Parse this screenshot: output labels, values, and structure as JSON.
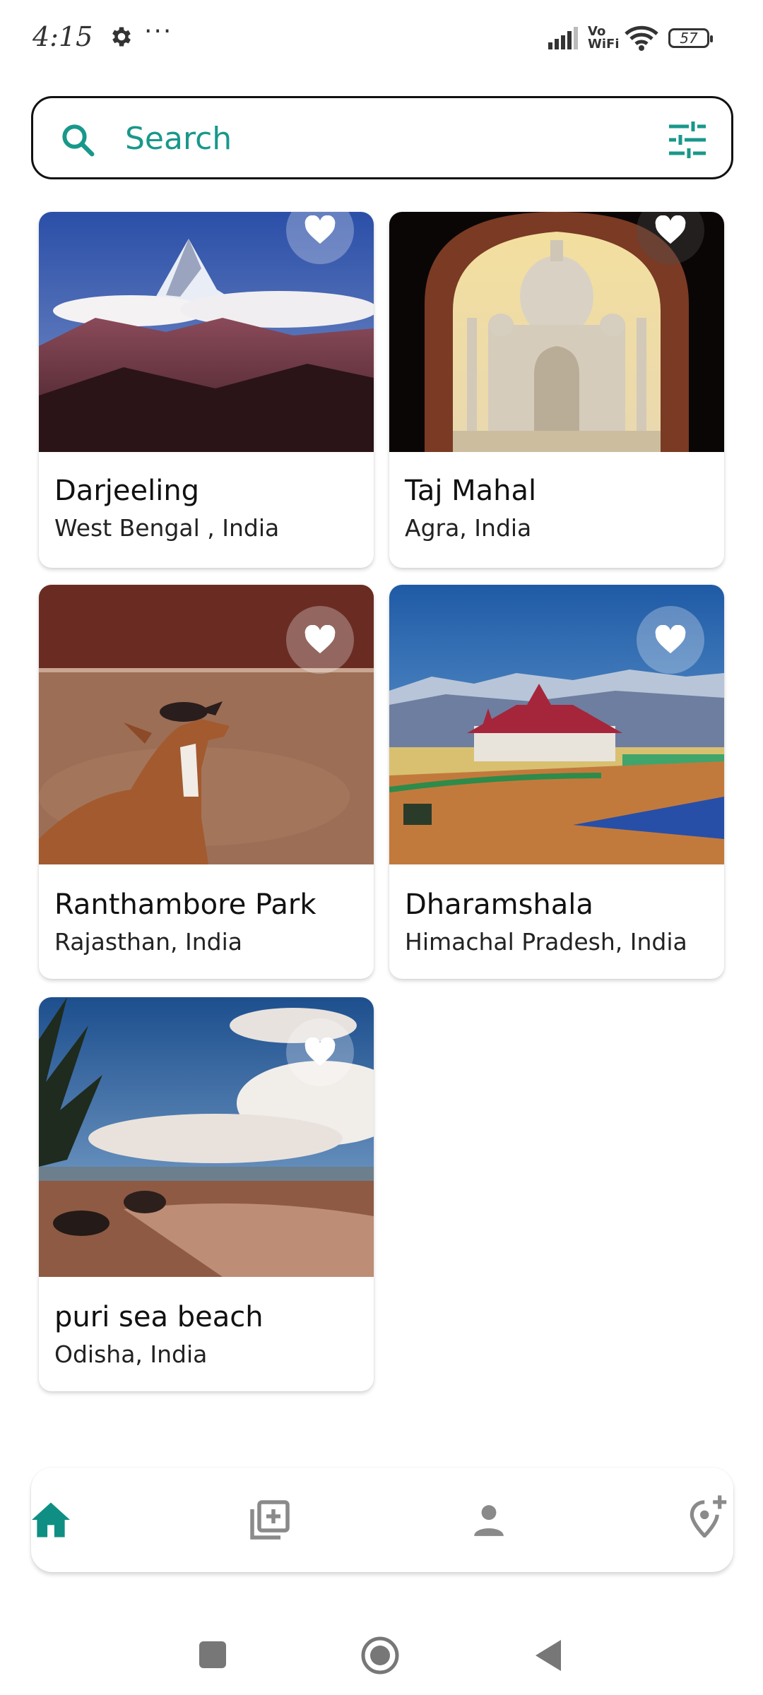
{
  "status_bar": {
    "time": "4:15",
    "more": "···",
    "network_label_top": "Vo",
    "network_label_bottom": "WiFi",
    "battery": "57"
  },
  "search": {
    "placeholder": "Search",
    "value": "",
    "accent_color": "#18988b"
  },
  "places": [
    {
      "name": "Darjeeling",
      "location": "West Bengal , India",
      "photo": "mountain-photo",
      "favorite": true
    },
    {
      "name": "Taj Mahal",
      "location": "Agra, India",
      "photo": "taj-mahal-photo",
      "favorite": true
    },
    {
      "name": "Ranthambore Park",
      "location": "Rajasthan, India",
      "photo": "deer-photo",
      "favorite": true
    },
    {
      "name": "Dharamshala",
      "location": "Himachal Pradesh, India",
      "photo": "stadium-photo",
      "favorite": true
    },
    {
      "name": "puri sea beach",
      "location": "Odisha, India",
      "photo": "beach-photo",
      "favorite": true
    }
  ],
  "bottom_nav": {
    "items": [
      {
        "icon": "home-icon",
        "active": true
      },
      {
        "icon": "add-collection-icon",
        "active": false
      },
      {
        "icon": "person-icon",
        "active": false
      },
      {
        "icon": "add-location-icon",
        "active": false
      }
    ],
    "active_color": "#0f8f84",
    "inactive_color": "#8a8a8a"
  },
  "system_nav": {
    "items": [
      "recents-button",
      "home-button",
      "back-button"
    ]
  }
}
